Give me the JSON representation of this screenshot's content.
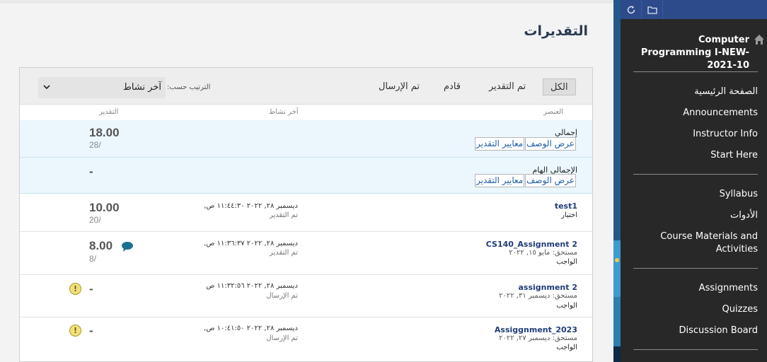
{
  "page": {
    "title": "التقديرات"
  },
  "sidebar": {
    "course_title": "Computer Programming I-NEW-2021-10",
    "items": [
      {
        "label": "الصفحة الرئيسية"
      },
      {
        "label": "Announcements"
      },
      {
        "label": "Instructor Info"
      },
      {
        "label": "Start Here"
      },
      {
        "label": "Syllabus"
      },
      {
        "label": "الأدوات"
      },
      {
        "label": "Course Materials and Activities"
      },
      {
        "label": "Assignments"
      },
      {
        "label": "Quizzes"
      },
      {
        "label": "Discussion Board"
      }
    ]
  },
  "filters": {
    "all": "الكل",
    "graded": "تم التقدير",
    "upcoming": "قادم",
    "submitted": "تم الإرسال"
  },
  "sort": {
    "label": "الترتيب حسب:",
    "value": "آخر نشاط"
  },
  "columns": {
    "item": "العنصر",
    "last_activity": "آخر نشاط",
    "grade": "التقدير"
  },
  "rows": [
    {
      "name": "إجمالي",
      "btn_desc": "عرض الوصف",
      "btn_rubric": "معايير التقدير",
      "grade": "18.00",
      "out_of": "28/"
    },
    {
      "name": "الإجمالي الهام",
      "btn_desc": "عرض الوصف",
      "btn_rubric": "معايير التقدير",
      "grade": "-"
    },
    {
      "name": "test1",
      "type": "اختبار",
      "activity": "ديسمبر ٢٨, ٢٠٢٢ ١١:٤٤:٣٠ ص,",
      "status": "تم التقدير",
      "grade": "10.00",
      "out_of": "20/"
    },
    {
      "name": "CS140_Assignment 2",
      "due": "مستحق: مايو ١٥, ٢٠٢٢",
      "type": "الواجب",
      "activity": "ديسمبر ٢٨, ٢٠٢٢ ١١:٣٦:٣٧ ص,",
      "status": "تم التقدير",
      "grade": "8.00",
      "out_of": "8/"
    },
    {
      "name": "assignment 2",
      "due": "مستحق: ديسمبر ٣١, ٢٠٢٢",
      "type": "الواجب",
      "activity": "ديسمبر ٢٨, ٢٠٢٢ ١١:٣٢:٥٦ ص",
      "status": "تم الإرسال",
      "grade": "-"
    },
    {
      "name": "Assiggnment_2023",
      "due": "مستحق: ديسمبر ٢٧, ٢٠٢٢",
      "type": "الواجب",
      "activity": "ديسمبر ٢٨, ٢٠٢٢ ١٠:٤١:٥٠ ص,",
      "status": "تم الإرسال",
      "grade": "-"
    }
  ],
  "icons": {
    "refresh": "refresh-icon",
    "folder": "folder-icon",
    "home": "home-icon",
    "sort_chevron": "chevron-down-icon",
    "comment": "comment-icon",
    "needs_grading": "exclamation-icon"
  },
  "colors": {
    "sidebar_bg": "#282828",
    "sidebar_top_bar": "#2d4a8a",
    "link": "#1f3c78",
    "highlight_row": "#ebf7fd"
  }
}
